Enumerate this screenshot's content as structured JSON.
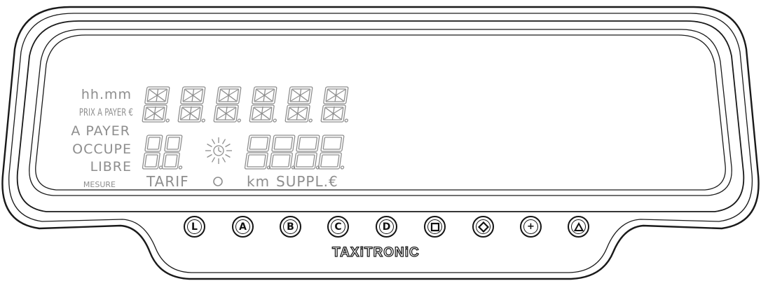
{
  "labels": {
    "hh_mm": "hh.mm",
    "prix_a_payer": "PRIX A PAYER €",
    "a_payer": "A PAYER",
    "occupe": "OCCUPE",
    "libre": "LIBRE",
    "mesure": "MESURE",
    "tarif": "TARIF",
    "km": "km",
    "suppl": "SUPPL.€"
  },
  "buttons": [
    {
      "name": "L",
      "label": "L"
    },
    {
      "name": "A",
      "label": "A"
    },
    {
      "name": "B",
      "label": "B"
    },
    {
      "name": "C",
      "label": "C"
    },
    {
      "name": "D",
      "label": "D"
    },
    {
      "name": "square",
      "icon": "square-icon"
    },
    {
      "name": "diamond",
      "icon": "diamond-icon"
    },
    {
      "name": "plus",
      "label": "+"
    },
    {
      "name": "triangle",
      "icon": "triangle-icon"
    }
  ],
  "brand": "TAXiTRONiC",
  "colors": {
    "outline": "#1a1a1a",
    "lcd_segment": "#8e8e8e",
    "background": "#ffffff"
  }
}
